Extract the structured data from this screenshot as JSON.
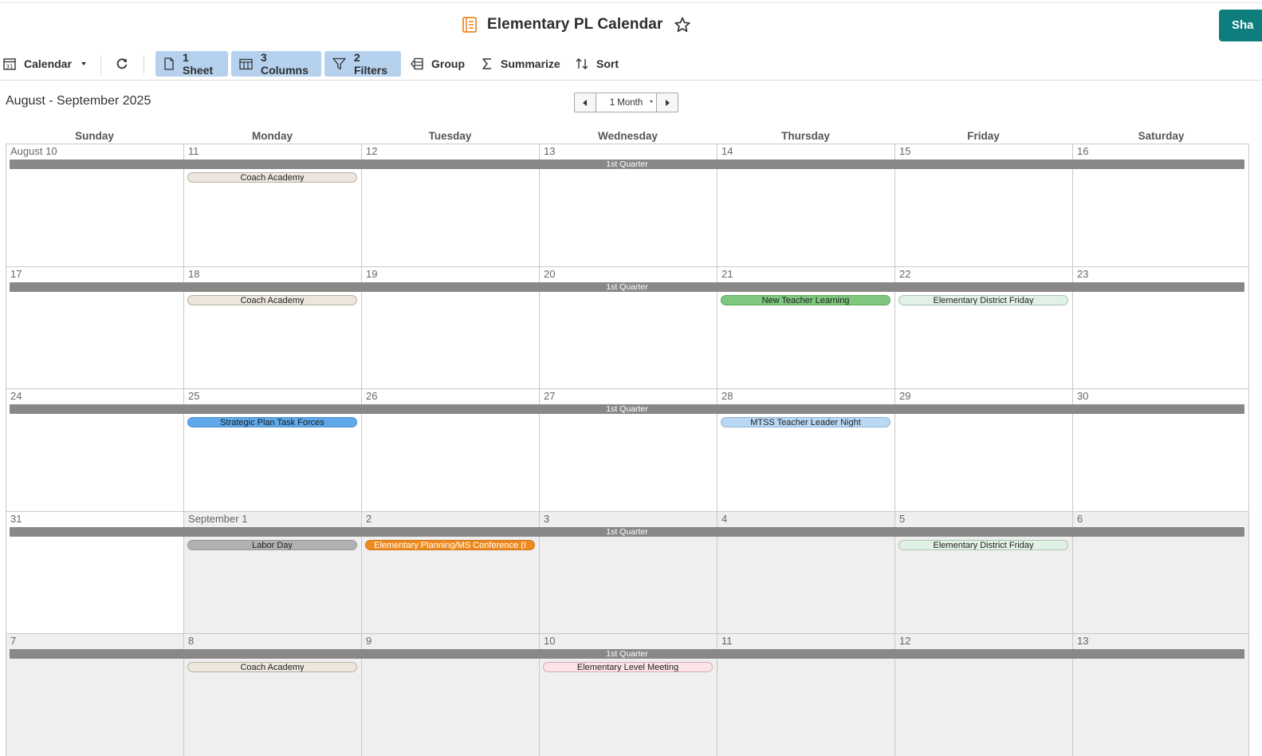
{
  "header": {
    "title": "Elementary PL Calendar",
    "share_label": "Sha"
  },
  "toolbar": {
    "view_label": "Calendar",
    "sheet_label": "1 Sheet",
    "columns_label": "3 Columns",
    "filters_label": "2 Filters",
    "group_label": "Group",
    "summarize_label": "Summarize",
    "sort_label": "Sort"
  },
  "calendar": {
    "range_title": "August - September 2025",
    "view_select": "1 Month",
    "weekdays": [
      "Sunday",
      "Monday",
      "Tuesday",
      "Wednesday",
      "Thursday",
      "Friday",
      "Saturday"
    ],
    "quarter_label": "1st Quarter",
    "weeks": [
      {
        "days": [
          "August 10",
          "11",
          "12",
          "13",
          "14",
          "15",
          "16"
        ],
        "outside": [
          false,
          false,
          false,
          false,
          false,
          false,
          false
        ],
        "events": [
          {
            "day": 1,
            "title": "Coach Academy",
            "bg": "#ece6dc",
            "border": "#b8b0a4",
            "color": "#222"
          }
        ]
      },
      {
        "days": [
          "17",
          "18",
          "19",
          "20",
          "21",
          "22",
          "23"
        ],
        "outside": [
          false,
          false,
          false,
          false,
          false,
          false,
          false
        ],
        "events": [
          {
            "day": 1,
            "title": "Coach Academy",
            "bg": "#ece6dc",
            "border": "#b8b0a4",
            "color": "#222"
          },
          {
            "day": 4,
            "title": "New Teacher Learning",
            "bg": "#7fc77f",
            "border": "#5aa55a",
            "color": "#1d1d1d"
          },
          {
            "day": 5,
            "title": "Elementary District Friday",
            "bg": "#e2f1e6",
            "border": "#a9c4b0",
            "color": "#222"
          }
        ]
      },
      {
        "days": [
          "24",
          "25",
          "26",
          "27",
          "28",
          "29",
          "30"
        ],
        "outside": [
          false,
          false,
          false,
          false,
          false,
          false,
          false
        ],
        "events": [
          {
            "day": 1,
            "title": "Strategic Plan Task Forces",
            "bg": "#5fa9ea",
            "border": "#4a8fcc",
            "color": "#1a1a1a"
          },
          {
            "day": 4,
            "title": "MTSS Teacher Leader Night",
            "bg": "#b9d8f4",
            "border": "#8fb4d6",
            "color": "#222"
          }
        ]
      },
      {
        "days": [
          "31",
          "September 1",
          "2",
          "3",
          "4",
          "5",
          "6"
        ],
        "outside": [
          false,
          true,
          true,
          true,
          true,
          true,
          true
        ],
        "events": [
          {
            "day": 1,
            "title": "Labor Day",
            "bg": "#b1b1b1",
            "border": "#969696",
            "color": "#222"
          },
          {
            "day": 2,
            "title": "Elementary Planning/MS Conference (I",
            "bg": "#ef8a1e",
            "border": "#d0741a",
            "color": "#ffffff"
          },
          {
            "day": 5,
            "title": "Elementary District Friday",
            "bg": "#e2f1e6",
            "border": "#a9c4b0",
            "color": "#222"
          }
        ]
      },
      {
        "days": [
          "7",
          "8",
          "9",
          "10",
          "11",
          "12",
          "13"
        ],
        "outside": [
          true,
          true,
          true,
          true,
          true,
          true,
          true
        ],
        "events": [
          {
            "day": 1,
            "title": "Coach Academy",
            "bg": "#ece6dc",
            "border": "#b8b0a4",
            "color": "#222"
          },
          {
            "day": 3,
            "title": "Elementary Level Meeting",
            "bg": "#fbe3e7",
            "border": "#d9aab2",
            "color": "#222"
          }
        ]
      }
    ]
  },
  "icons": {
    "sheet": "sheet-icon",
    "star": "star-icon",
    "calendar": "calendar-icon",
    "refresh": "refresh-icon",
    "columns": "columns-icon",
    "filter": "filter-icon",
    "group": "group-icon",
    "summarize": "sigma-icon",
    "sort": "sort-icon",
    "prev": "triangle-left-icon",
    "next": "triangle-right-icon"
  },
  "colors": {
    "accent": "#0e7d7e",
    "active_toolbar": "#b5d1ee",
    "quarter_bar": "#8a8787",
    "outside_month_bg": "#efefef"
  }
}
